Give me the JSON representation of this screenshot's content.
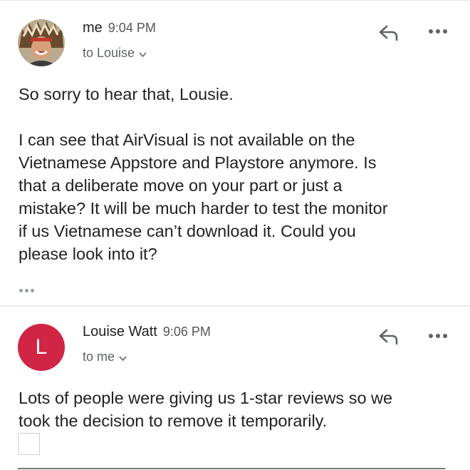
{
  "messages": [
    {
      "sender": "me",
      "time": "9:04 PM",
      "recipient": "to Louise",
      "avatar": "profile-photo",
      "body": {
        "line1": "So sorry to hear that, Lousie.",
        "para2_lines": [
          "I can see that AirVisual is not available on the",
          "Vietnamese Appstore and Playstore anymore. Is",
          "that a deliberate move on your part or just a",
          "mistake? It will be much harder to test the monitor",
          "if us Vietnamese can’t download it. Could you",
          "please look into it?"
        ]
      }
    },
    {
      "sender": "Louise Watt",
      "time": "9:06 PM",
      "recipient": "to me",
      "avatar_letter": "L",
      "body": {
        "lines": [
          "Lots of people were giving us 1-star reviews so we",
          "took the decision to remove it temporarily."
        ]
      }
    }
  ],
  "colors": {
    "avatar_letter_bg": "#d12546",
    "icon_gray": "#5f6368",
    "text": "#222222"
  },
  "icons": [
    "reply-icon",
    "more-options-icon",
    "chevron-down-icon",
    "quoted-text-ellipsis-icon"
  ]
}
